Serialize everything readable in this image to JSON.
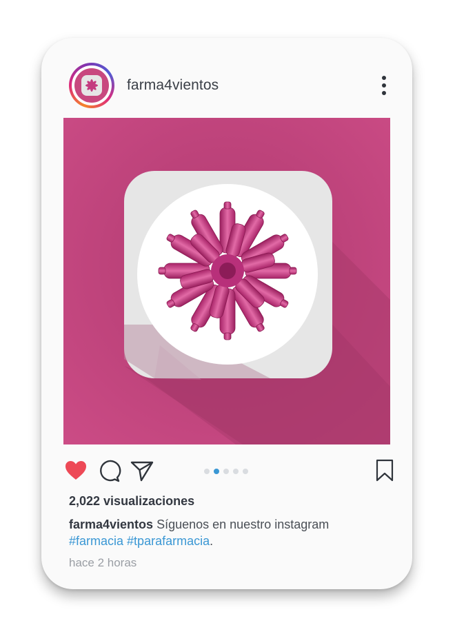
{
  "header": {
    "username": "farma4vientos",
    "avatar_icon": "brand-logo-icon",
    "menu_icon": "more-vertical-icon"
  },
  "post": {
    "image_description_icon": "app-icon-flower-bottles"
  },
  "actions": {
    "like_icon": "heart-icon",
    "comment_icon": "comment-icon",
    "share_icon": "send-icon",
    "save_icon": "bookmark-icon",
    "liked": true,
    "carousel_total": 5,
    "carousel_active": 2
  },
  "stats": {
    "views": "2,022 visualizaciones"
  },
  "caption": {
    "user": "farma4vientos",
    "text": "Síguenos en nuestro instagram",
    "tag1": "#farmacia",
    "tag2": "#tparafarmacia",
    "end": "."
  },
  "timestamp": "hace 2 horas",
  "colors": {
    "pink": "#c84b83",
    "like_red": "#ed4956",
    "link_blue": "#3a97d4"
  }
}
